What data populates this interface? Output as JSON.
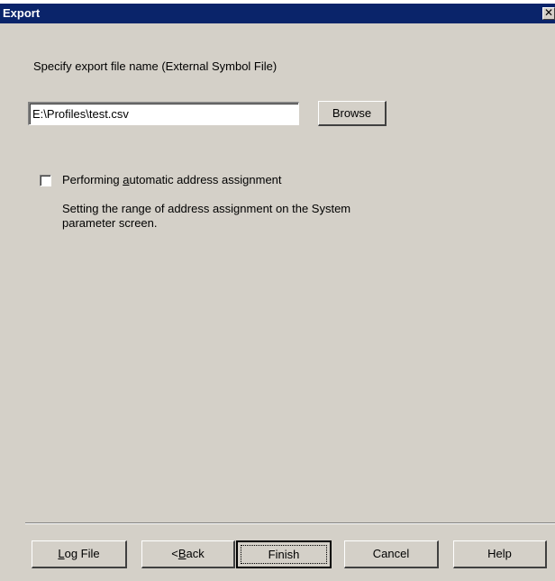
{
  "window": {
    "title": "Export",
    "close_glyph": "✕"
  },
  "main": {
    "instruction_label": "Specify export file name (External Symbol File)",
    "file_path_value": "E:\\Profiles\\test.csv",
    "browse_label": "Browse",
    "auto_assign": {
      "label_prefix": "Performing ",
      "label_mnemonic": "a",
      "label_suffix": "utomatic address assignment",
      "checked": false
    },
    "note_line1": "Setting the range of address assignment on the System",
    "note_line2": "parameter screen."
  },
  "footer": {
    "log_file": {
      "mnemonic": "L",
      "rest": "og File"
    },
    "back": {
      "prefix": "<",
      "mnemonic": "B",
      "rest": "ack"
    },
    "finish_label": "Finish",
    "cancel_label": "Cancel",
    "help_label": "Help"
  }
}
